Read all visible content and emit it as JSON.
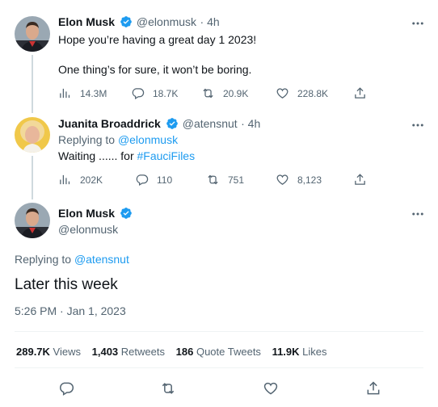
{
  "tweet1": {
    "name": "Elon Musk",
    "handle": "@elonmusk",
    "time": "· 4h",
    "line1": "Hope you’re having a great day 1 2023!",
    "line2": "One thing’s for sure, it won’t be boring.",
    "views": "14.3M",
    "replies": "18.7K",
    "retweets": "20.9K",
    "likes": "228.8K"
  },
  "tweet2": {
    "name": "Juanita Broaddrick",
    "handle": "@atensnut",
    "time": "· 4h",
    "replying_prefix": "Replying to",
    "replying_to": "@elonmusk",
    "text_prefix": "Waiting ...... for",
    "hashtag": "#FauciFiles",
    "views": "202K",
    "replies": "110",
    "retweets": "751",
    "likes": "8,123"
  },
  "main_tweet": {
    "name": "Elon Musk",
    "handle": "@elonmusk",
    "replying_prefix": "Replying to",
    "replying_to": "@atensnut",
    "text": "Later this week",
    "timestamp": "5:26 PM · Jan 1, 2023"
  },
  "stats": {
    "views_num": "289.7K",
    "views_lbl": "Views",
    "retweets_num": "1,403",
    "retweets_lbl": "Retweets",
    "quotes_num": "186",
    "quotes_lbl": "Quote Tweets",
    "likes_num": "11.9K",
    "likes_lbl": "Likes"
  },
  "icons": {
    "verified": "verified-badge-icon",
    "more": "more-options-icon",
    "views": "analytics-icon",
    "reply": "reply-icon",
    "retweet": "retweet-icon",
    "like": "heart-icon",
    "share": "share-icon"
  },
  "colors": {
    "accent": "#1d9bf0",
    "muted": "#536471",
    "text": "#0f1419",
    "divider": "#eff3f4"
  }
}
